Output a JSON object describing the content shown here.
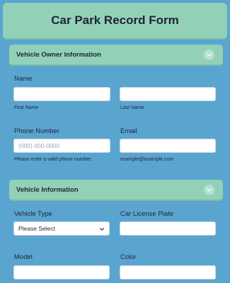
{
  "form": {
    "title": "Car Park Record Form"
  },
  "section_owner": {
    "title": "Vehicle Owner Information"
  },
  "name": {
    "label": "Name",
    "first_sublabel": "First Name",
    "last_sublabel": "Last Name",
    "first_value": "",
    "last_value": ""
  },
  "phone": {
    "label": "Phone Number",
    "placeholder": "(000) 000-0000",
    "hint": "Please enter a valid phone number."
  },
  "email": {
    "label": "Email",
    "hint": "example@example.com"
  },
  "section_vehicle": {
    "title": "Vehicle Information"
  },
  "vehicle_type": {
    "label": "Vehicle Type",
    "selected": "Please Select"
  },
  "license_plate": {
    "label": "Car License Plate"
  },
  "model": {
    "label": "Model"
  },
  "color": {
    "label": "Color"
  },
  "icons": {
    "section_toggle": "chevron-down-icon",
    "select_caret": "chevron-down-icon"
  },
  "colors": {
    "form_bg": "#5aa5d0",
    "header_bg": "#93d0b8",
    "text": "#1f2433"
  }
}
